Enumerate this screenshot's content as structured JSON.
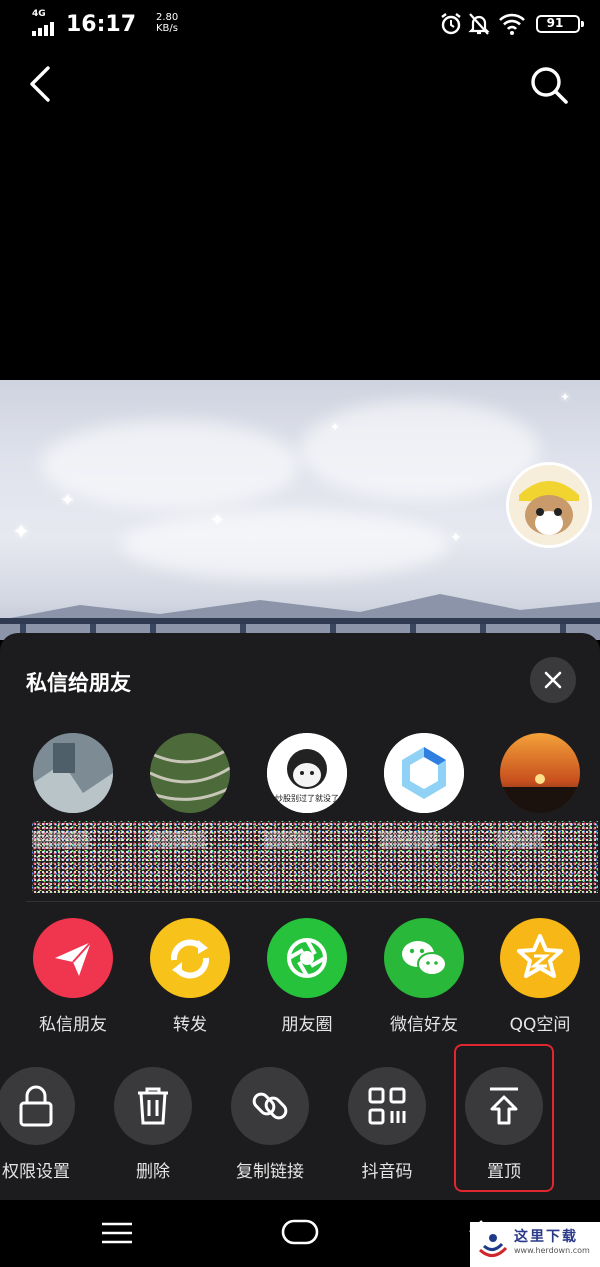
{
  "status_bar": {
    "network": "4G",
    "time": "16:17",
    "speed_value": "2.80",
    "speed_unit": "KB/s",
    "battery": "91",
    "icons": [
      "alarm-icon",
      "mute-bell-icon",
      "wifi-icon",
      "battery-icon"
    ]
  },
  "topbar": {
    "back_icon": "chevron-left-icon",
    "search_icon": "search-icon"
  },
  "share_sheet": {
    "title": "私信给朋友",
    "close_icon": "close-icon",
    "friends": [
      {
        "avatar": "friend-avatar-1"
      },
      {
        "avatar": "friend-avatar-2"
      },
      {
        "avatar": "friend-avatar-3",
        "caption": "炒股别过了就没了"
      },
      {
        "avatar": "friend-avatar-4"
      },
      {
        "avatar": "friend-avatar-5"
      }
    ],
    "share_targets": [
      {
        "label": "私信朋友",
        "icon": "paper-plane-icon",
        "color": "#f0354f"
      },
      {
        "label": "转发",
        "icon": "repost-icon",
        "color": "#f7c21a"
      },
      {
        "label": "朋友圈",
        "icon": "moments-icon",
        "color": "#27c23c"
      },
      {
        "label": "微信好友",
        "icon": "wechat-icon",
        "color": "#2ab83a"
      },
      {
        "label": "QQ空间",
        "icon": "qzone-star-icon",
        "color": "#f7b817"
      }
    ],
    "tools": [
      {
        "label": "权限设置",
        "icon": "lock-icon"
      },
      {
        "label": "删除",
        "icon": "trash-icon"
      },
      {
        "label": "复制链接",
        "icon": "link-icon"
      },
      {
        "label": "抖音码",
        "icon": "qr-code-icon"
      },
      {
        "label": "置顶",
        "icon": "pin-top-icon"
      }
    ]
  },
  "watermark": {
    "text": "这里下载",
    "url": "www.herdown.com"
  }
}
